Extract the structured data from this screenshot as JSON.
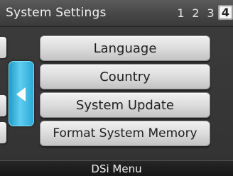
{
  "header": {
    "title": "System Settings",
    "pages": [
      "1",
      "2",
      "3",
      "4"
    ],
    "current_page": "4"
  },
  "menu": {
    "items": [
      {
        "label": "Language"
      },
      {
        "label": "Country"
      },
      {
        "label": "System Update"
      },
      {
        "label": "Format System Memory"
      }
    ]
  },
  "footer": {
    "label": "DSi Menu"
  },
  "colors": {
    "accent": "#3bb8e3",
    "button_face": "#dcdcdc",
    "background": "#363636"
  },
  "icons": {
    "back": "left-arrow-icon"
  }
}
